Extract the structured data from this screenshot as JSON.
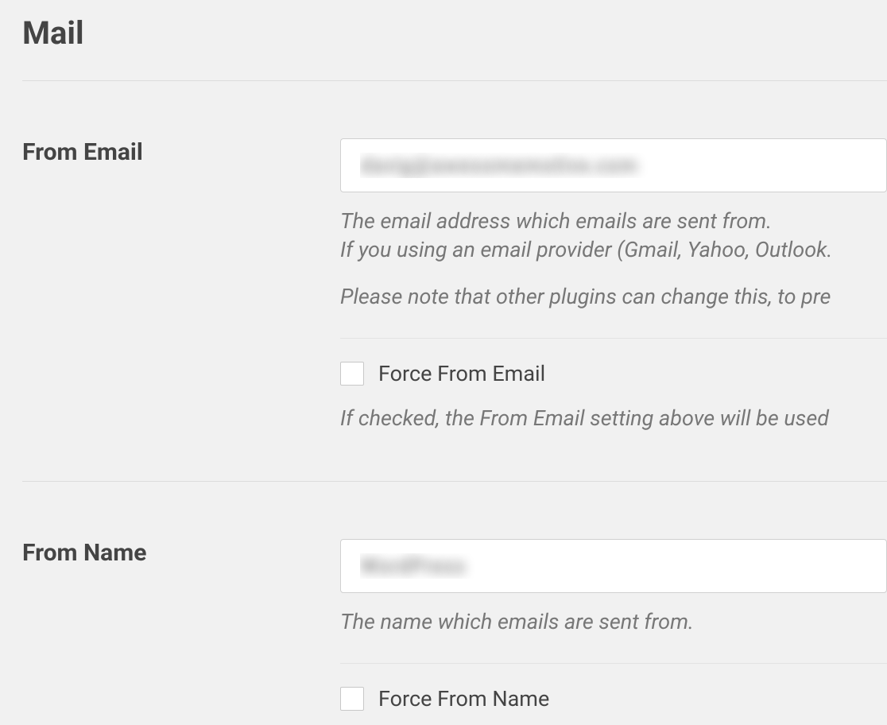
{
  "section": {
    "title": "Mail"
  },
  "fromEmail": {
    "label": "From Email",
    "value": "davig@awesomemotive.com",
    "help1": "The email address which emails are sent from.",
    "help2": "If you using an email provider (Gmail, Yahoo, Outlook.",
    "help3": "Please note that other plugins can change this, to pre",
    "forceLabel": "Force From Email",
    "forceHelp": "If checked, the From Email setting above will be used"
  },
  "fromName": {
    "label": "From Name",
    "value": "WordPress",
    "help1": "The name which emails are sent from.",
    "forceLabel": "Force From Name"
  }
}
